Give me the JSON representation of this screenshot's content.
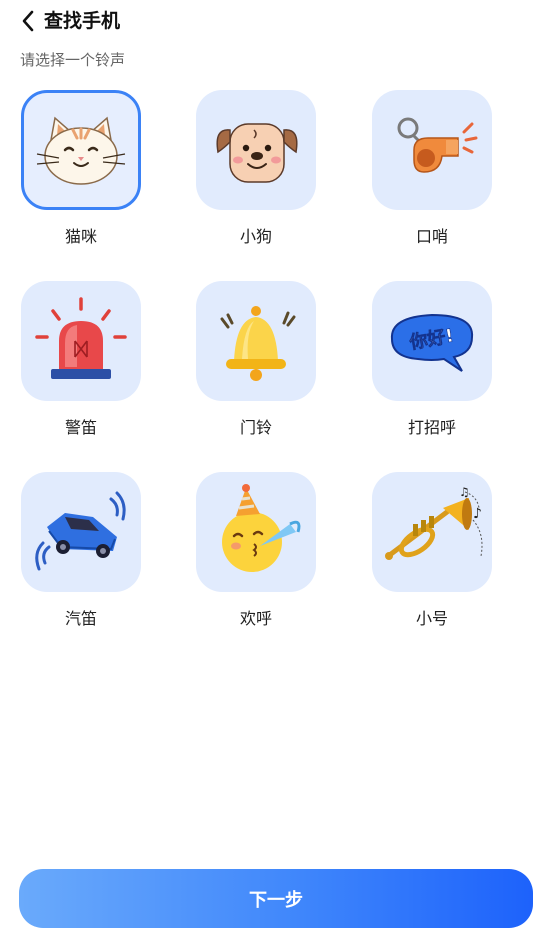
{
  "header": {
    "title": "查找手机",
    "back_icon": "chevron-left-icon"
  },
  "subtitle": "请选择一个铃声",
  "ringtones": [
    {
      "label": "猫咪",
      "icon": "cat-icon",
      "selected": true
    },
    {
      "label": "小狗",
      "icon": "dog-icon",
      "selected": false
    },
    {
      "label": "口哨",
      "icon": "whistle-icon",
      "selected": false
    },
    {
      "label": "警笛",
      "icon": "siren-icon",
      "selected": false
    },
    {
      "label": "门铃",
      "icon": "bell-icon",
      "selected": false
    },
    {
      "label": "打招呼",
      "icon": "greeting-bubble-icon",
      "bubble_text": "你好!",
      "selected": false
    },
    {
      "label": "汽笛",
      "icon": "car-horn-icon",
      "selected": false
    },
    {
      "label": "欢呼",
      "icon": "party-face-icon",
      "selected": false
    },
    {
      "label": "小号",
      "icon": "trumpet-icon",
      "selected": false
    }
  ],
  "footer": {
    "next_label": "下一步"
  },
  "colors": {
    "tile_background": "#e1ebfd",
    "selected_border": "#3b82f6",
    "button_gradient_start": "#6aaafb",
    "button_gradient_end": "#1d62fb"
  }
}
